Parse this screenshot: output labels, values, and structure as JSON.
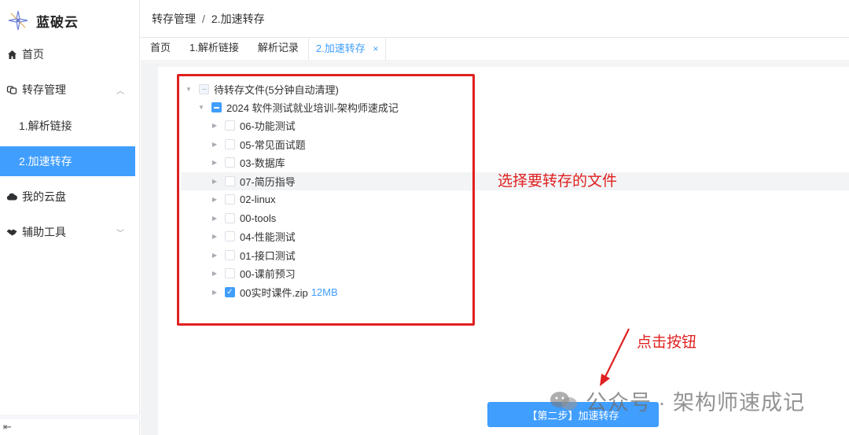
{
  "app": {
    "name": "蓝破云"
  },
  "sidebar": {
    "items": [
      {
        "label": "首页",
        "icon": "home-icon"
      },
      {
        "label": "转存管理",
        "icon": "transfer-icon"
      },
      {
        "label": "1.解析链接"
      },
      {
        "label": "2.加速转存",
        "active": true
      },
      {
        "label": "我的云盘",
        "icon": "cloud-icon"
      },
      {
        "label": "辅助工具",
        "icon": "handshake-icon"
      }
    ],
    "collapse_glyph": "⇤"
  },
  "breadcrumb": {
    "parent": "转存管理",
    "separator": "/",
    "current": "2.加速转存"
  },
  "tabs": [
    {
      "label": "首页"
    },
    {
      "label": "1.解析链接"
    },
    {
      "label": "解析记录"
    },
    {
      "label": "2.加速转存",
      "active": true,
      "close": "×"
    }
  ],
  "tree": {
    "root": "待转存文件(5分钟自动清理)",
    "folder": "2024 软件测试就业培训-架构师速成记",
    "items": [
      {
        "label": "06-功能测试"
      },
      {
        "label": "05-常见面试题"
      },
      {
        "label": "03-数据库"
      },
      {
        "label": "07-简历指导"
      },
      {
        "label": "02-linux"
      },
      {
        "label": "00-tools"
      },
      {
        "label": "04-性能测试"
      },
      {
        "label": "01-接口测试"
      },
      {
        "label": "00-课前预习"
      },
      {
        "label": "00实时课件.zip",
        "size": "12MB",
        "checked": true
      }
    ]
  },
  "annotations": {
    "select_files": "选择要转存的文件",
    "click_button": "点击按钮"
  },
  "actions": {
    "transfer_button": "【第二步】加速转存"
  },
  "watermark": {
    "text": "公众号 · 架构师速成记"
  },
  "colors": {
    "accent": "#409eff",
    "annotation": "#e02020"
  }
}
